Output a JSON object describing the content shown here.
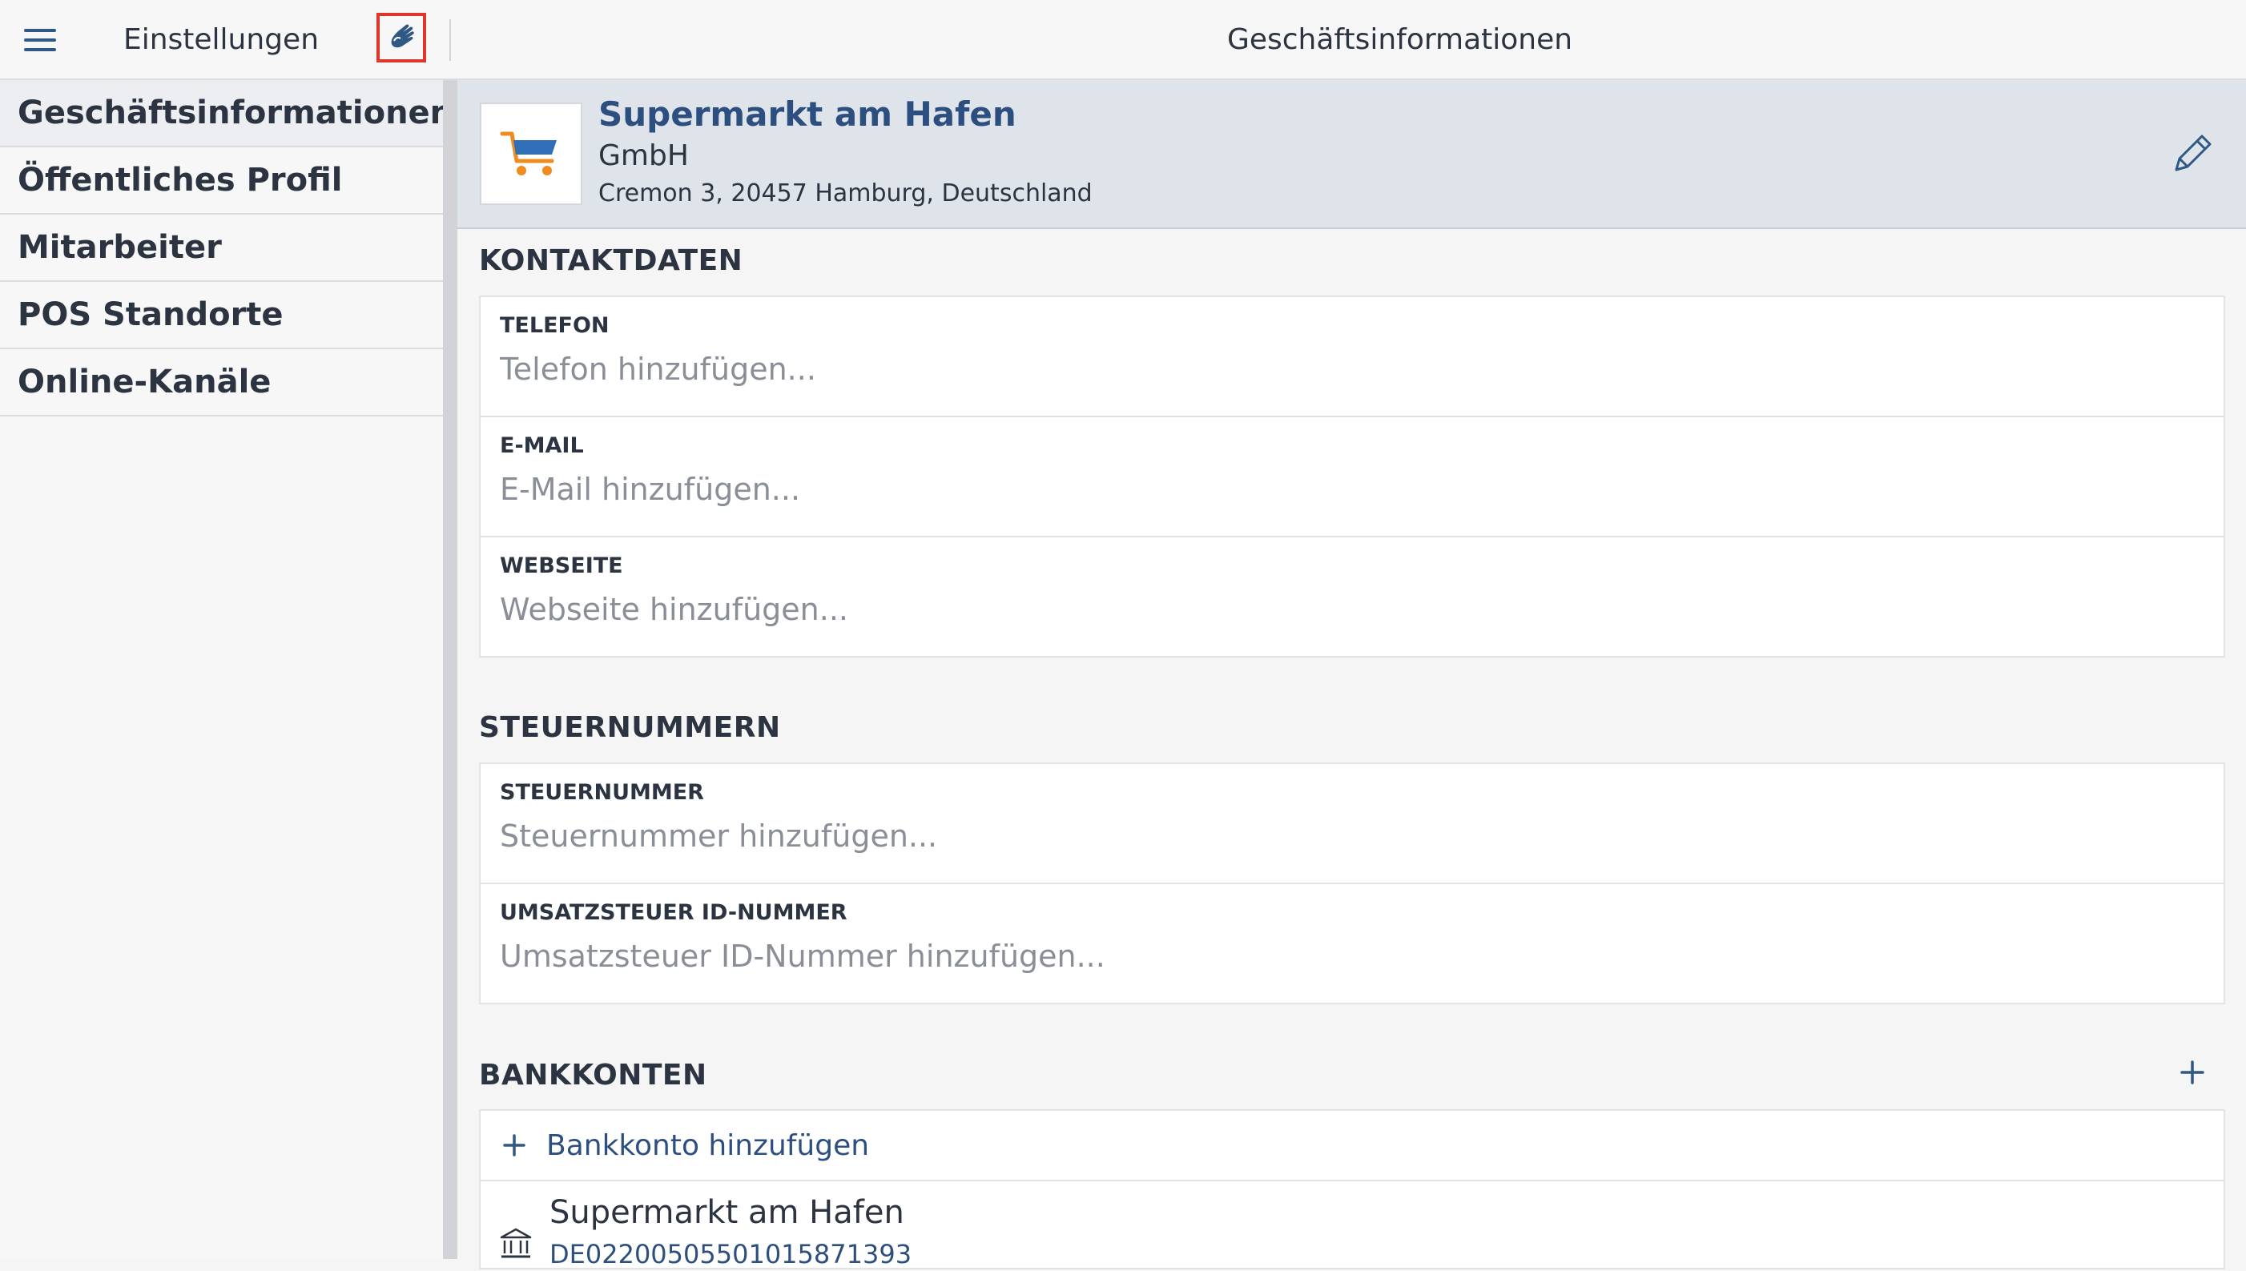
{
  "sidebar": {
    "title": "Einstellungen",
    "items": [
      {
        "label": "Geschäftsinformationen"
      },
      {
        "label": "Öffentliches Profil"
      },
      {
        "label": "Mitarbeiter"
      },
      {
        "label": "POS Standorte"
      },
      {
        "label": "Online-Kanäle"
      }
    ]
  },
  "main": {
    "title": "Geschäftsinformationen",
    "business": {
      "name": "Supermarkt am Hafen",
      "legal_form": "GmbH",
      "address": "Cremon 3, 20457 Hamburg, Deutschland"
    },
    "contact": {
      "title": "KONTAKTDATEN",
      "fields": [
        {
          "label": "TELEFON",
          "placeholder": "Telefon hinzufügen..."
        },
        {
          "label": "E-MAIL",
          "placeholder": "E-Mail hinzufügen..."
        },
        {
          "label": "WEBSEITE",
          "placeholder": "Webseite hinzufügen..."
        }
      ]
    },
    "tax": {
      "title": "STEUERNUMMERN",
      "fields": [
        {
          "label": "STEUERNUMMER",
          "placeholder": "Steuernummer hinzufügen..."
        },
        {
          "label": "UMSATZSTEUER ID-NUMMER",
          "placeholder": "Umsatzsteuer ID-Nummer hinzufügen..."
        }
      ]
    },
    "bank": {
      "title": "BANKKONTEN",
      "add_label": "Bankkonto hinzufügen",
      "accounts": [
        {
          "name": "Supermarkt am Hafen",
          "iban": "DE02200505501015871393"
        }
      ]
    }
  },
  "colors": {
    "accent": "#2d4f80",
    "highlight_border": "#e0352b",
    "cart_orange": "#f08c1e",
    "cart_blue": "#2f6fb7"
  },
  "icons": [
    "menu-icon",
    "hand-icon",
    "cart-icon",
    "pencil-icon",
    "plus-icon",
    "bank-icon"
  ]
}
